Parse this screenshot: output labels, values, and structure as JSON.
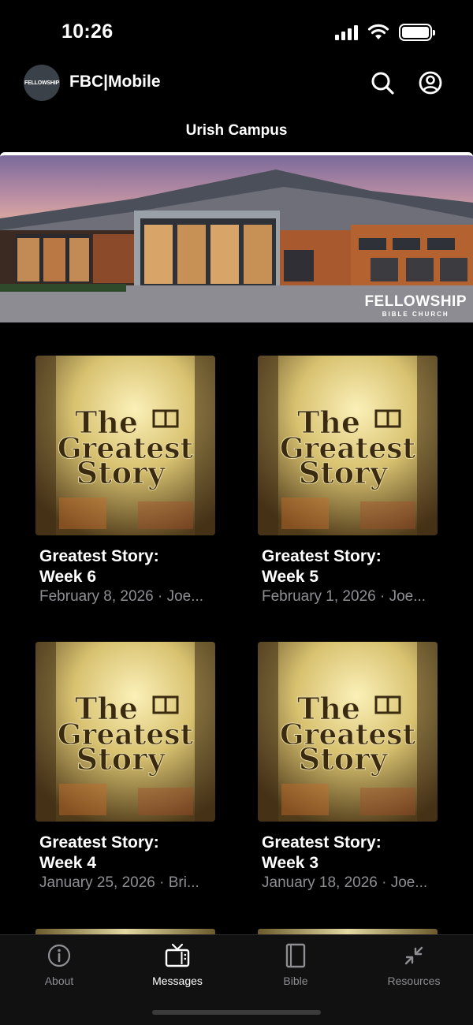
{
  "status": {
    "time": "10:26"
  },
  "header": {
    "app_title": "FBC|Mobile",
    "logo_text": "FELLOWSHIP"
  },
  "campus": {
    "title": "Urish Campus"
  },
  "banner": {
    "brand_name": "FELLOWSHIP",
    "brand_sub": "BIBLE CHURCH"
  },
  "artwork": {
    "line1": "The",
    "line2": "Greatest",
    "line3": "Story"
  },
  "messages": [
    {
      "title_line1": "Greatest Story:",
      "title_line2": "Week 6",
      "meta": "February 8, 2026 · Joe..."
    },
    {
      "title_line1": "Greatest Story:",
      "title_line2": "Week 5",
      "meta": "February 1, 2026 · Joe..."
    },
    {
      "title_line1": "Greatest Story:",
      "title_line2": "Week 4",
      "meta": "January 25, 2026 · Bri..."
    },
    {
      "title_line1": "Greatest Story:",
      "title_line2": "Week 3",
      "meta": "January 18, 2026 · Joe..."
    }
  ],
  "tabs": [
    {
      "label": "About",
      "icon": "info-icon",
      "active": false
    },
    {
      "label": "Messages",
      "icon": "tv-icon",
      "active": true
    },
    {
      "label": "Bible",
      "icon": "book-icon",
      "active": false
    },
    {
      "label": "Resources",
      "icon": "collapse-arrows-icon",
      "active": false
    }
  ],
  "colors": {
    "background": "#000000",
    "muted_text": "#8e8e93",
    "tab_bar": "#111111"
  }
}
